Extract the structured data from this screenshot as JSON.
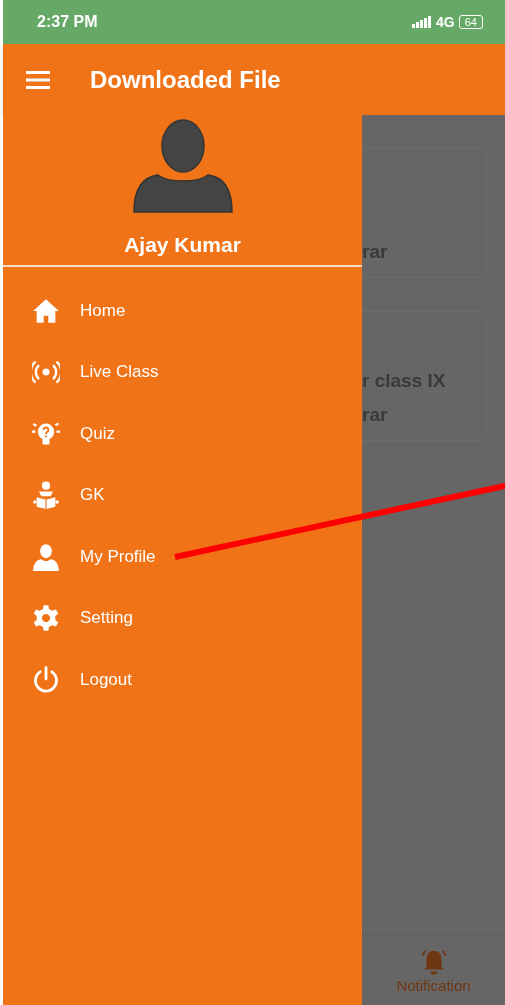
{
  "status_bar": {
    "time": "2:37 PM",
    "network": "4G",
    "battery": "64"
  },
  "app_bar": {
    "title": "Downloaded File"
  },
  "drawer": {
    "user_name": "Ajay Kumar",
    "items": [
      {
        "label": "Home"
      },
      {
        "label": "Live Class"
      },
      {
        "label": "Quiz"
      },
      {
        "label": "GK"
      },
      {
        "label": "My Profile"
      },
      {
        "label": "Setting"
      },
      {
        "label": "Logout"
      }
    ]
  },
  "background_cards": [
    {
      "lines": [
        "rar"
      ]
    },
    {
      "lines": [
        "r class IX",
        "rar"
      ]
    }
  ],
  "bottom_nav": {
    "label": "Notification"
  }
}
